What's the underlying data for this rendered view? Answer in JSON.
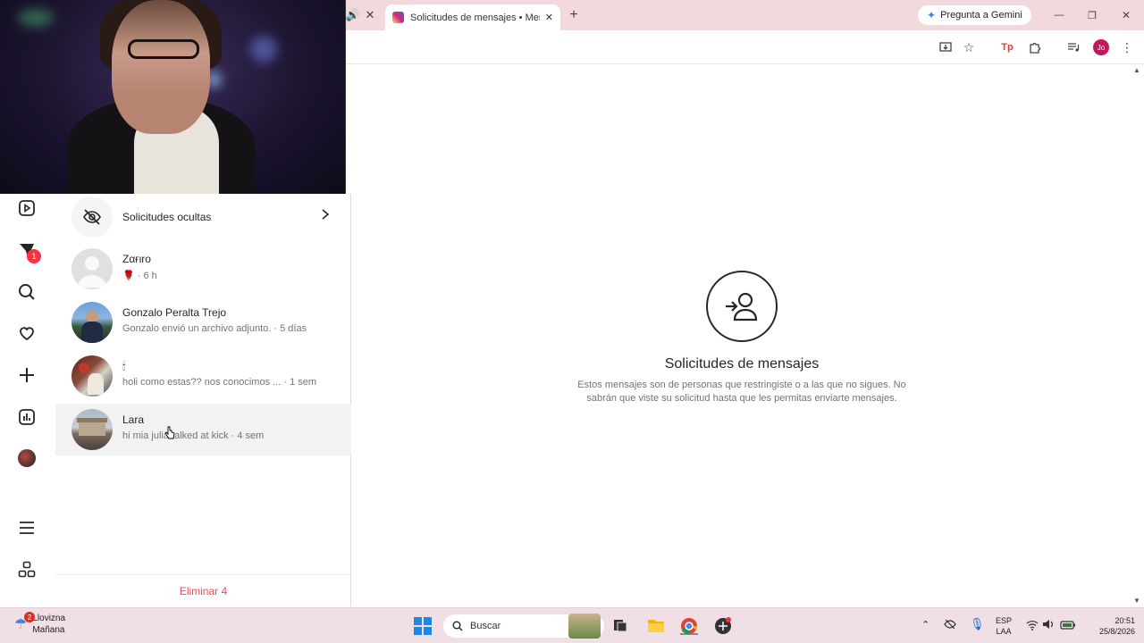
{
  "browser": {
    "active_tab_title": "Solicitudes de mensajes • Mens",
    "new_tab_symbol": "+",
    "gemini_label": "Pregunta a Gemini",
    "profile_initials": "Jo",
    "minimize_symbol": "—",
    "maximize_symbol": "❐",
    "close_symbol": "✕"
  },
  "nav": {
    "notification_count": "1"
  },
  "requests": {
    "hidden_label": "Solicitudes ocultas",
    "items": [
      {
        "name": "Zαғιro",
        "subtitle": "🌹 · 6 h"
      },
      {
        "name": "Gonzalo Peralta Trejo",
        "subtitle": "Gonzalo envió un archivo adjunto. · 5 días"
      },
      {
        "name": "🕯",
        "subtitle": "holi como estas?? nos conocimos ... · 1 sem"
      },
      {
        "name": "Lara",
        "subtitle": "hi mia julia talked at kick · 4 sem"
      }
    ],
    "delete_label": "Eliminar 4"
  },
  "main": {
    "title": "Solicitudes de mensajes",
    "description": "Estos mensajes son de personas que restringiste o a las que no sigues. No sabrán que viste su solicitud hasta que les permitas enviarte mensajes."
  },
  "taskbar": {
    "weather_badge": "2",
    "weather_line1": "Llovizna",
    "weather_line2": "Mañana",
    "search_placeholder": "Buscar",
    "lang_line1": "ESP",
    "lang_line2": "LAA",
    "time": "20:51",
    "date": "25/8/2026"
  },
  "colors": {
    "accent_red": "#ff3040",
    "delete_red": "#ed4956",
    "tabstrip": "#f3d9dc",
    "taskbar": "#f0dfe4"
  }
}
